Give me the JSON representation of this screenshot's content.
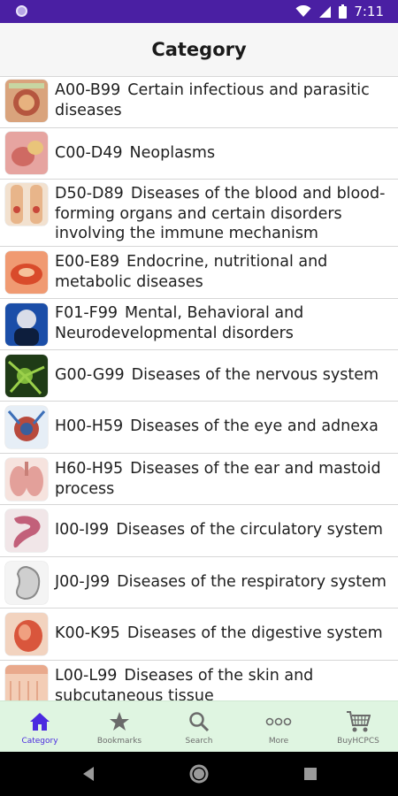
{
  "status": {
    "time": "7:11"
  },
  "app": {
    "title": "Category"
  },
  "categories": [
    {
      "code": "A00-B99",
      "name": "Certain infectious and parasitic diseases"
    },
    {
      "code": "C00-D49",
      "name": "Neoplasms"
    },
    {
      "code": "D50-D89",
      "name": "Diseases of the blood and blood-forming organs and certain disorders involving the immune mechanism"
    },
    {
      "code": "E00-E89",
      "name": "Endocrine, nutritional and metabolic diseases"
    },
    {
      "code": "F01-F99",
      "name": "Mental, Behavioral and Neurodevelopmental disorders"
    },
    {
      "code": "G00-G99",
      "name": "Diseases of the nervous system"
    },
    {
      "code": "H00-H59",
      "name": "Diseases of the eye and adnexa"
    },
    {
      "code": "H60-H95",
      "name": "Diseases of the ear and mastoid process"
    },
    {
      "code": "I00-I99",
      "name": "Diseases of the circulatory system"
    },
    {
      "code": "J00-J99",
      "name": "Diseases of the respiratory system"
    },
    {
      "code": "K00-K95",
      "name": "Diseases of the digestive system"
    },
    {
      "code": "L00-L99",
      "name": "Diseases of the skin and subcutaneous tissue"
    }
  ],
  "nav": {
    "category": "Category",
    "bookmarks": "Bookmarks",
    "search": "Search",
    "more": "More",
    "buy": "BuyHCPCS"
  },
  "colors": {
    "status_bar": "#4a1fa3",
    "nav_background": "#dff5e1",
    "nav_active": "#4a2ae0"
  },
  "icons": {
    "status": [
      "wifi-icon",
      "signal-icon",
      "battery-icon"
    ],
    "nav": [
      "home-icon",
      "star-icon",
      "search-icon",
      "more-dots-icon",
      "cart-icon"
    ],
    "system": [
      "back-icon",
      "home-circle-icon",
      "recents-square-icon"
    ]
  }
}
